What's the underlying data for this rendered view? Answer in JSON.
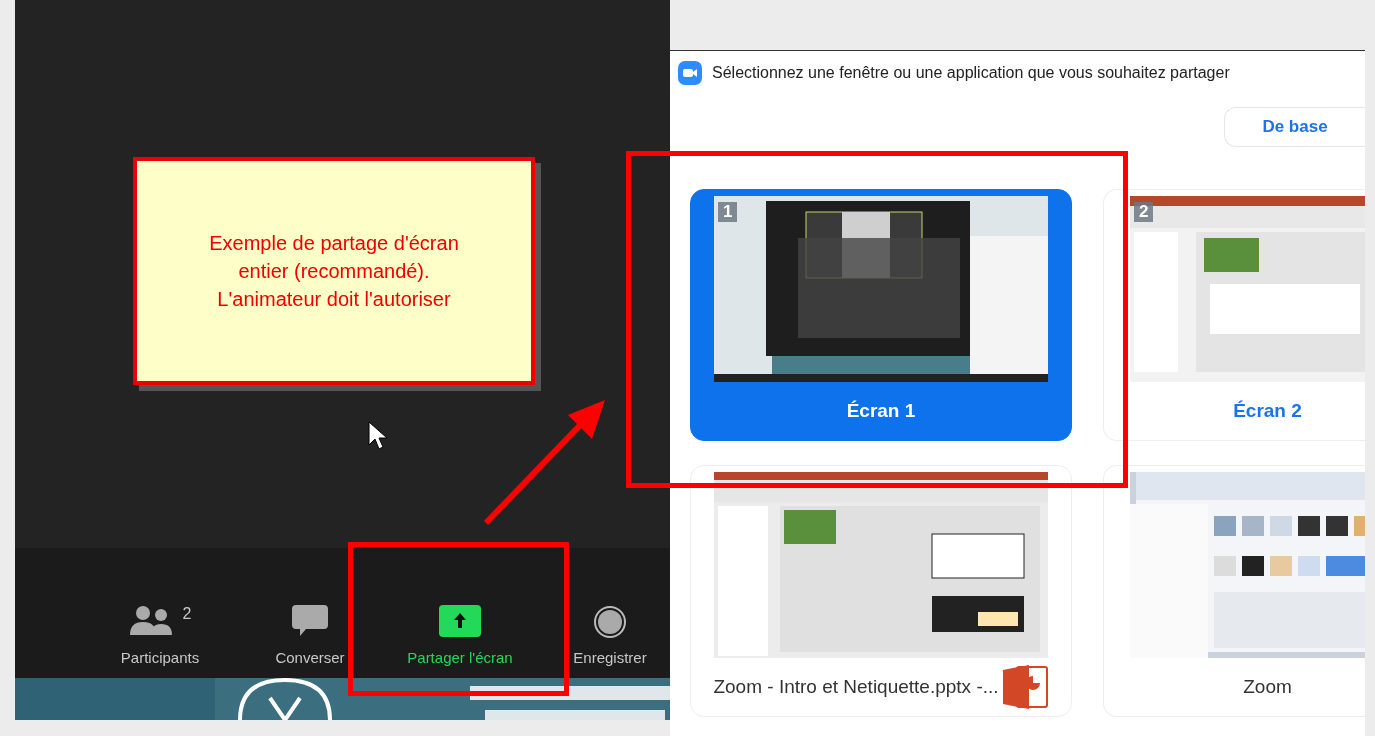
{
  "meeting": {
    "toolbar": [
      {
        "kind": "participants",
        "label": "Participants",
        "count": "2",
        "highlighted": false
      },
      {
        "kind": "chat",
        "label": "Converser",
        "highlighted": false
      },
      {
        "kind": "share",
        "label": "Partager l'écran",
        "highlighted": true
      },
      {
        "kind": "record",
        "label": "Enregistrer",
        "highlighted": false
      }
    ]
  },
  "annotation": {
    "note": "Exemple de partage d'écran\nentier (recommandé).\nL'animateur doit l'autoriser"
  },
  "share_dialog": {
    "title": "Sélectionnez une fenêtre ou une application que vous souhaitez partager",
    "mode_button": "De base",
    "sources": [
      {
        "kind": "screen",
        "badge": "1",
        "label": "Écran 1",
        "selected": true
      },
      {
        "kind": "screen",
        "badge": "2",
        "label": "Écran 2",
        "selected": false
      },
      {
        "kind": "presentation",
        "label": "Zoom - Intro et Netiquette.pptx -...",
        "selected": false
      },
      {
        "kind": "window",
        "label": "Zoom",
        "selected": false
      }
    ]
  }
}
